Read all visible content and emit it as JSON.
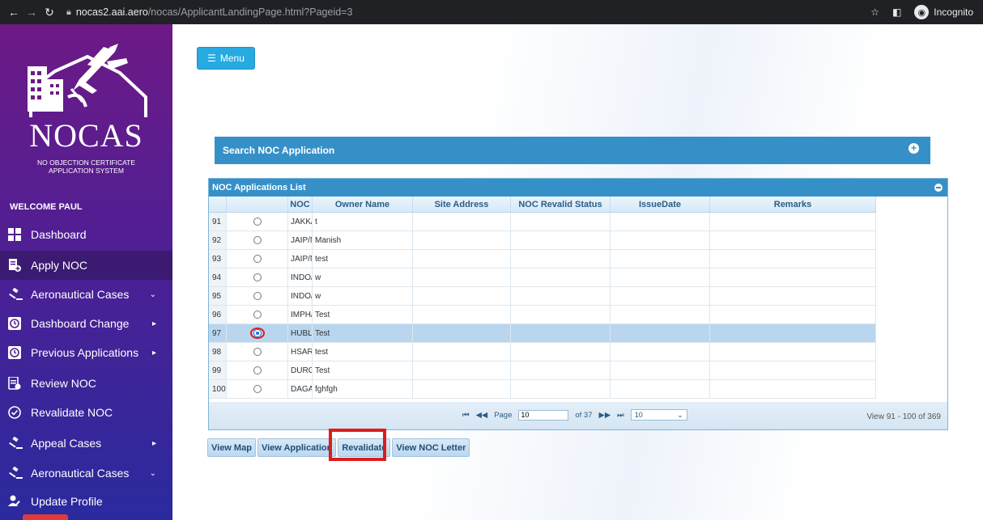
{
  "browser": {
    "url_host": "nocas2.aai.aero",
    "url_path": "/nocas/ApplicantLandingPage.html?Pageid=3",
    "incognito_label": "Incognito"
  },
  "sidebar": {
    "logo_title": "NOCAS",
    "logo_subtitle_1": "NO OBJECTION CERTIFICATE",
    "logo_subtitle_2": "APPLICATION SYSTEM",
    "welcome": "WELCOME PAUL",
    "items": [
      {
        "label": "Dashboard",
        "icon": "dashboard-icon",
        "caret": ""
      },
      {
        "label": "Apply NOC",
        "icon": "apply-noc-icon",
        "caret": ""
      },
      {
        "label": "Aeronautical Cases",
        "icon": "gavel-icon",
        "caret": "⌄"
      },
      {
        "label": "Dashboard Change",
        "icon": "clock-icon",
        "caret": "▸"
      },
      {
        "label": "Previous Applications",
        "icon": "clock-icon",
        "caret": "▸"
      },
      {
        "label": "Review NOC",
        "icon": "document-icon",
        "caret": ""
      },
      {
        "label": "Revalidate NOC",
        "icon": "check-circle-icon",
        "caret": ""
      },
      {
        "label": "Appeal Cases",
        "icon": "gavel-icon",
        "caret": "▸"
      },
      {
        "label": "Aeronautical Cases",
        "icon": "gavel-icon",
        "caret": "⌄"
      },
      {
        "label": "Update Profile",
        "icon": "user-edit-icon",
        "caret": ""
      }
    ]
  },
  "main": {
    "menu_label": "Menu",
    "search_title": "Search NOC Application",
    "grid_title": "NOC Applications List",
    "columns": [
      "",
      "",
      "NOC",
      "Owner Name",
      "Site Address",
      "NOC Revalid Status",
      "IssueDate",
      "Remarks"
    ],
    "rows": [
      {
        "num": "91",
        "noc": "JAKK/!",
        "owner": "t",
        "selected": false
      },
      {
        "num": "92",
        "noc": "JAIP/N",
        "owner": "Manish",
        "selected": false
      },
      {
        "num": "93",
        "noc": "JAIP/N",
        "owner": "test",
        "selected": false
      },
      {
        "num": "94",
        "noc": "INDO/",
        "owner": "w",
        "selected": false
      },
      {
        "num": "95",
        "noc": "INDO/",
        "owner": "w",
        "selected": false
      },
      {
        "num": "96",
        "noc": "IMPH/",
        "owner": "Test",
        "selected": false
      },
      {
        "num": "97",
        "noc": "HUBL/",
        "owner": "Test",
        "selected": true
      },
      {
        "num": "98",
        "noc": "HSAR/",
        "owner": "test",
        "selected": false
      },
      {
        "num": "99",
        "noc": "DURG,",
        "owner": "Test",
        "selected": false
      },
      {
        "num": "100",
        "noc": "DAGA,",
        "owner": "fghfgh",
        "selected": false
      }
    ],
    "pager": {
      "first": "⏮",
      "prev": "◀◀",
      "page_label": "Page",
      "page_value": "10",
      "of_label": "of 37",
      "next": "▶▶",
      "last": "⏭",
      "page_size": "10",
      "view_text": "View 91 - 100 of 369"
    },
    "buttons": {
      "view_map": "View Map",
      "view_application": "View Application",
      "revalidate": "Revalidate",
      "view_noc_letter": "View NOC Letter"
    }
  }
}
